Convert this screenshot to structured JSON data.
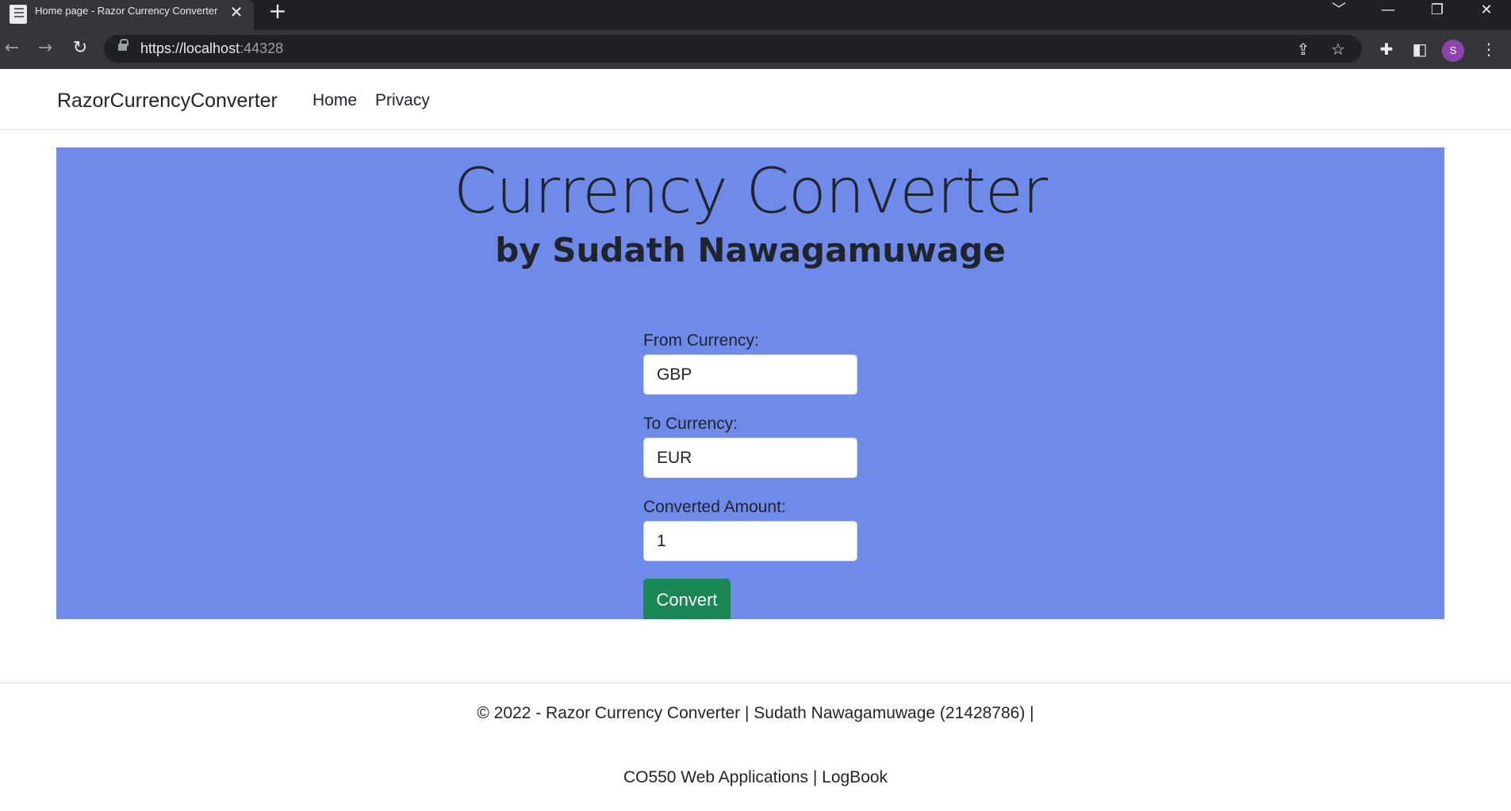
{
  "browser": {
    "tab_title": "Home page - Razor Currency Converter",
    "tab_close": "✕",
    "new_tab": "+",
    "url_host": "https://localhost",
    "url_port": ":44328",
    "profile_initial": "S",
    "window_controls": [
      "﹀",
      "—",
      "❐",
      "✕"
    ]
  },
  "navbar": {
    "brand": "RazorCurrencyConverter",
    "links": [
      "Home",
      "Privacy"
    ]
  },
  "hero": {
    "title": "Currency Converter",
    "subtitle": "by Sudath Nawagamuwage",
    "background": "#6e8be9"
  },
  "form": {
    "from_label": "From Currency:",
    "from_value": "GBP",
    "to_label": "To Currency:",
    "to_value": "EUR",
    "amount_label": "Converted Amount:",
    "amount_value": "1",
    "convert_label": "Convert",
    "convert_color": "#198754"
  },
  "footer": {
    "line1": "© 2022 - Razor Currency Converter | Sudath Nawagamuwage (21428786) |",
    "line2": "CO550 Web Applications | LogBook"
  }
}
